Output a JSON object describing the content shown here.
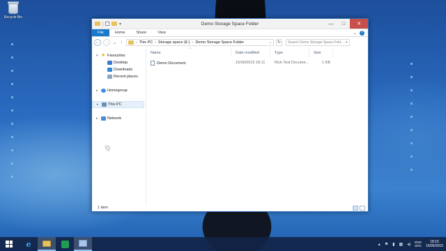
{
  "desktop": {
    "recycle_bin_label": "Recycle Bin"
  },
  "window": {
    "title": "Demo Storage Space Folder",
    "controls": {
      "minimize": "—",
      "maximize": "□",
      "close": "✕"
    }
  },
  "ribbon": {
    "tabs": [
      "File",
      "Home",
      "Share",
      "View"
    ],
    "help": "?"
  },
  "address_bar": {
    "back": "←",
    "forward": "→",
    "up": "↑",
    "segments": [
      "This PC",
      "Storage space (E:)",
      "Demo Storage Space Folder"
    ],
    "search_placeholder": "Search Demo Storage Space Fold..."
  },
  "nav_pane": {
    "favourites": "Favourites",
    "favourite_items": [
      "Desktop",
      "Downloads",
      "Recent places"
    ],
    "homegroup": "Homegroup",
    "this_pc": "This PC",
    "network": "Network"
  },
  "file_list": {
    "columns": [
      "Name",
      "Date modified",
      "Type",
      "Size"
    ],
    "rows": [
      {
        "name": "Demo Document",
        "date": "15/06/2015 18:11",
        "type": "Rich Text Docume...",
        "size": "1 KB"
      }
    ]
  },
  "status_bar": {
    "item_count": "1 item"
  },
  "taskbar": {
    "tray": {
      "lang_top": "ENG",
      "lang_bottom": "INTL",
      "time": "18:15",
      "date": "15/06/2015"
    }
  }
}
